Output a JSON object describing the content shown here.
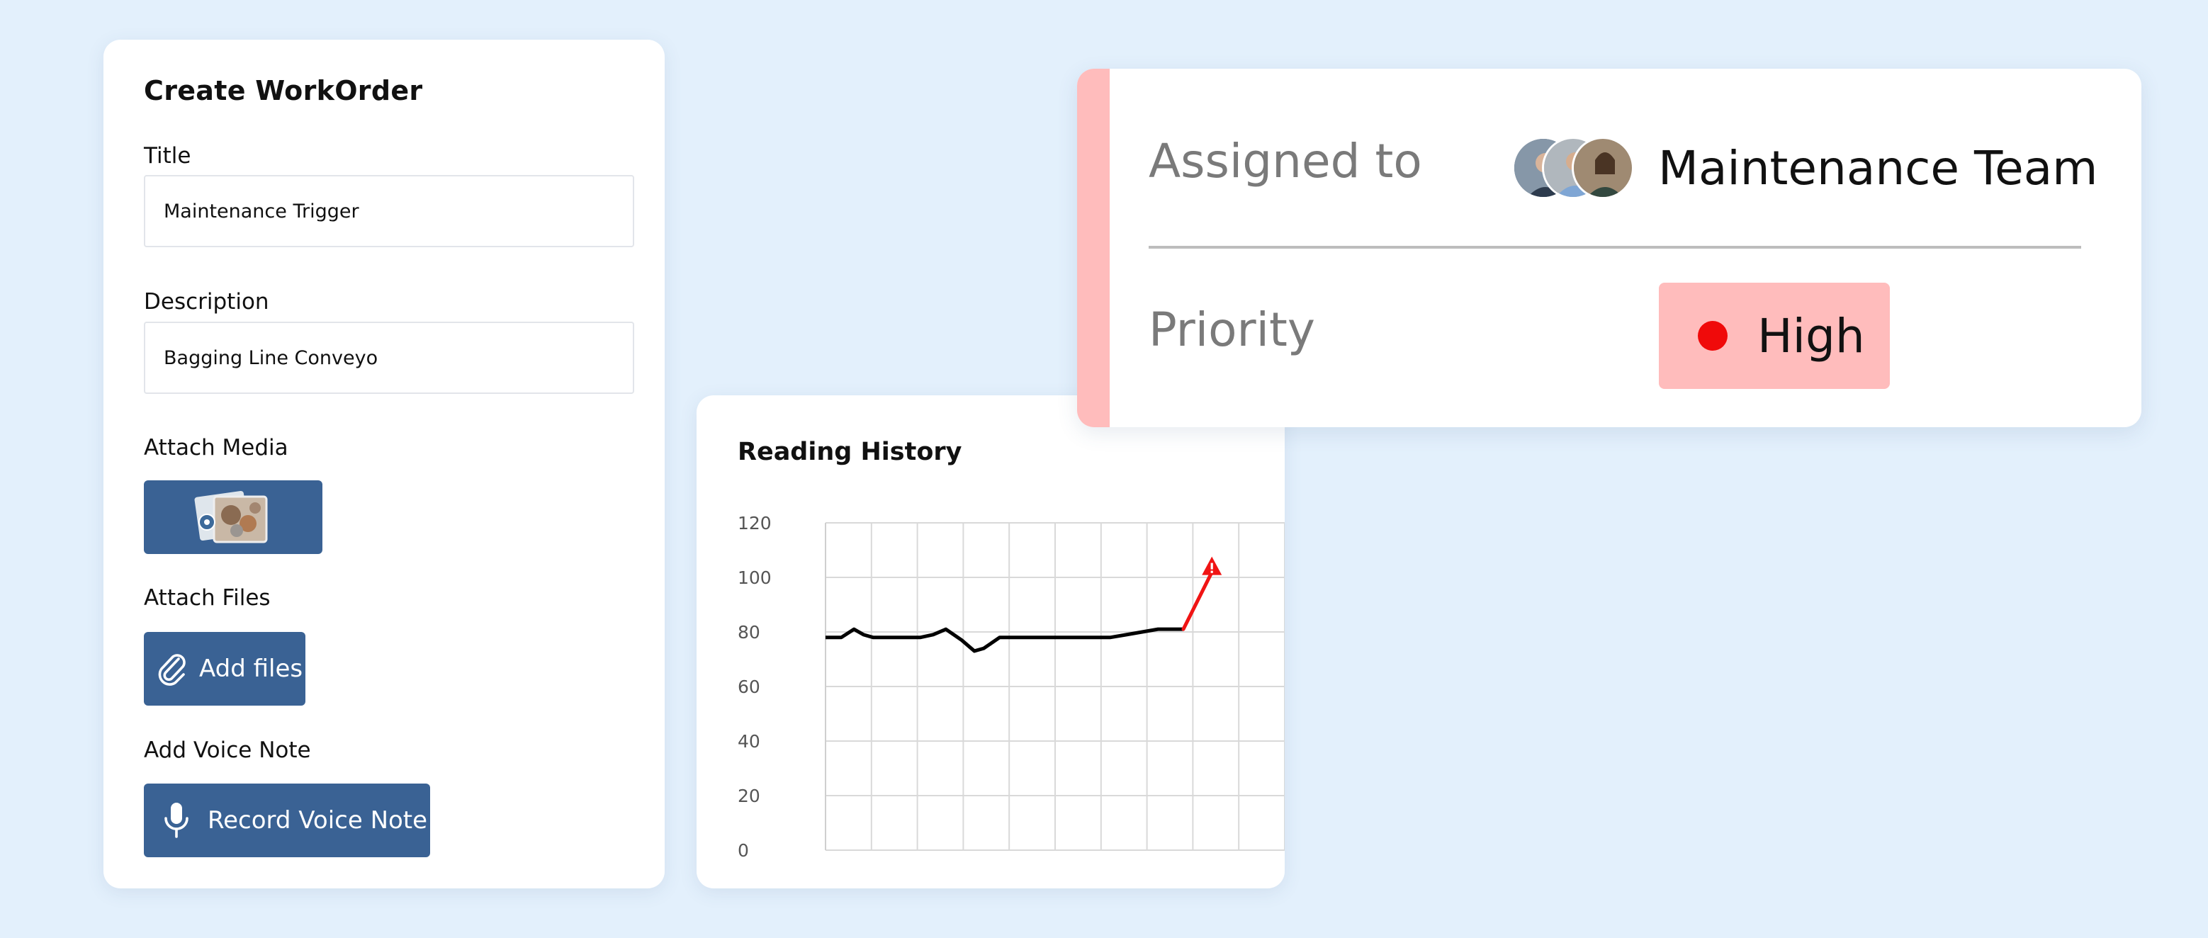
{
  "workorder": {
    "title": "Create WorkOrder",
    "title_label": "Title",
    "title_value": "Maintenance Trigger",
    "description_label": "Description",
    "description_value": "Bagging Line Conveyo",
    "attach_media_label": "Attach Media",
    "attach_files_label": "Attach Files",
    "add_files_button": "Add files",
    "voice_note_label": "Add Voice Note",
    "record_button": "Record Voice Note"
  },
  "reading_history": {
    "title": "Reading History"
  },
  "chart_data": {
    "type": "line",
    "title": "Reading History",
    "y_ticks": [
      "120",
      "100",
      "80",
      "60",
      "40",
      "20",
      "0"
    ],
    "ylim": [
      0,
      120
    ],
    "xlim": [
      0,
      14.5
    ],
    "grid": true,
    "x": [
      0,
      0.5,
      0.9,
      1.2,
      1.5,
      2.0,
      2.5,
      3.0,
      3.4,
      3.8,
      4.3,
      4.7,
      5.0,
      5.5,
      6.0,
      7.0,
      8.0,
      8.5,
      9.0,
      9.5,
      10.0,
      10.5,
      11.0,
      11.3
    ],
    "y": [
      78,
      78,
      81,
      79,
      78,
      78,
      78,
      78,
      79,
      81,
      77,
      73,
      74,
      78,
      78,
      78,
      78,
      78,
      78,
      79,
      80,
      81,
      81,
      81
    ],
    "alert": {
      "x": [
        11.3,
        12.2
      ],
      "y": [
        81,
        104
      ]
    },
    "colors": {
      "line": "#000000",
      "alert": "#f01414",
      "grid": "#d9d9d9"
    }
  },
  "assignment": {
    "assigned_label": "Assigned to",
    "team_name": "Maintenance Team",
    "priority_label": "Priority",
    "priority_value": "High",
    "colors": {
      "accent": "#ffbcbc",
      "priority_dot": "#f00a0a"
    }
  },
  "icons": {
    "media": "image-thumbnail-icon",
    "files": "paperclip-icon",
    "voice": "microphone-icon",
    "alert": "warning-triangle-icon"
  }
}
